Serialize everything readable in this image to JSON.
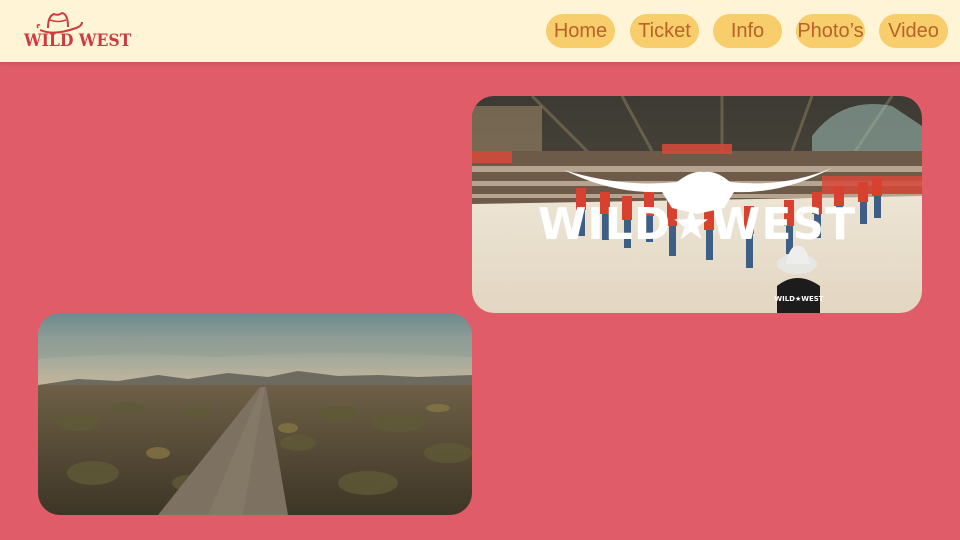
{
  "brand": {
    "logo_text": "WILD WEST",
    "primary_color": "#d03a3f",
    "header_bg": "#fff4d6",
    "page_bg": "#e05c69"
  },
  "nav": {
    "items": [
      {
        "label": "Home"
      },
      {
        "label": "Ticket"
      },
      {
        "label": "Info"
      },
      {
        "label": "Photo’s"
      },
      {
        "label": "Video"
      }
    ],
    "button_color": "#f8cd6b",
    "text_color": "#b9622a"
  },
  "media": {
    "event_photo": {
      "overlay_logo_text": "WILD★WEST",
      "shirt_text": "WILD★WEST"
    },
    "desert_photo": {}
  }
}
